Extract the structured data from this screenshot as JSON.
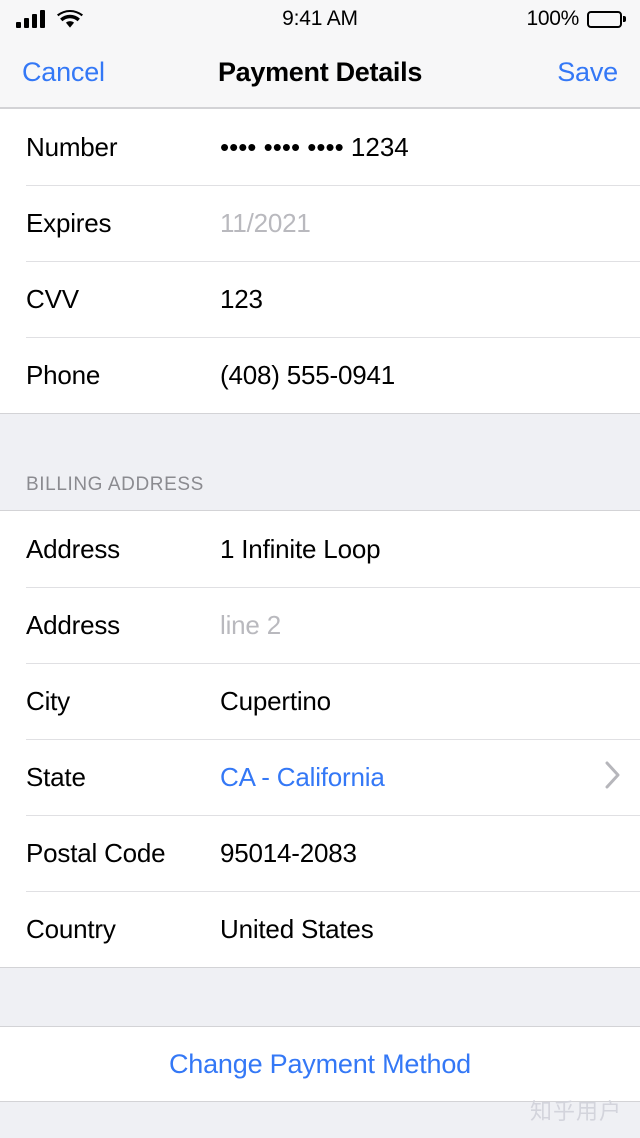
{
  "status_bar": {
    "signal_icon": "signal-bars-icon",
    "wifi_icon": "wifi-icon",
    "time": "9:41 AM",
    "battery_percent": "100%",
    "battery_icon": "battery-full-icon"
  },
  "nav_bar": {
    "cancel_label": "Cancel",
    "title": "Payment Details",
    "save_label": "Save"
  },
  "colors": {
    "accent_blue": "#3478f6",
    "placeholder_gray": "#b9b9be",
    "group_background": "#ffffff",
    "page_background": "#eff0f4",
    "separator": "#e0e0e3",
    "header_text": "#8b8b90"
  },
  "card_section": {
    "rows": [
      {
        "label": "Number",
        "value": "•••• •••• •••• 1234",
        "state": "filled"
      },
      {
        "label": "Expires",
        "value": "11/2021",
        "state": "placeholder"
      },
      {
        "label": "CVV",
        "value": "123",
        "state": "filled"
      },
      {
        "label": "Phone",
        "value": "(408) 555-0941",
        "state": "filled"
      }
    ]
  },
  "billing_section": {
    "header": "BILLING ADDRESS",
    "rows": [
      {
        "label": "Address",
        "value": "1 Infinite Loop",
        "state": "filled"
      },
      {
        "label": "Address",
        "value": "line 2",
        "state": "placeholder"
      },
      {
        "label": "City",
        "value": "Cupertino",
        "state": "filled"
      },
      {
        "label": "State",
        "value": "CA - California",
        "state": "link",
        "accessory": "chevron-right-icon"
      },
      {
        "label": "Postal Code",
        "value": "95014-2083",
        "state": "filled"
      },
      {
        "label": "Country",
        "value": "United States",
        "state": "filled"
      }
    ]
  },
  "footer": {
    "change_payment_label": "Change Payment Method",
    "watermark": "知乎用户"
  }
}
